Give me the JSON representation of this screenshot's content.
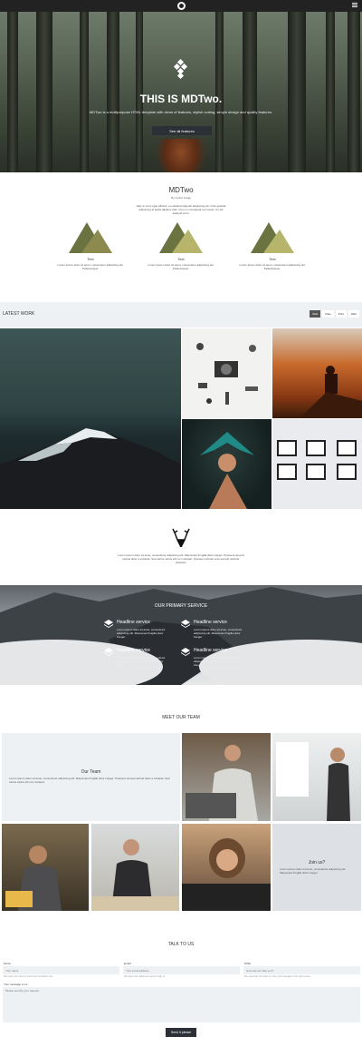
{
  "hero": {
    "title": "THIS IS MDTwo.",
    "subtitle": "MDTwo is a multipurpose HTML template with clean of features, stylish coding, simple design and quality features.",
    "button": "See all features"
  },
  "about": {
    "title": "MDTwo",
    "small": "By Andrei Iosagi",
    "text": "Nam in enim eget efficitur, eu eleifend eligendi adipiscing elit. Cras gravida adipiscing at ligula dapibus duis. Cum cu consequat commodo. Cu elit eleifend enim."
  },
  "features": [
    {
      "title": "Text",
      "desc": "Lorem ipsum dolor sit amet, consectetur adipiscing elit. Pellentesque."
    },
    {
      "title": "Text",
      "desc": "Lorem ipsum dolor sit amet, consectetur adipiscing elit. Pellentesque."
    },
    {
      "title": "Text",
      "desc": "Lorem ipsum dolor sit amet, consectetur adipiscing elit. Pellentesque."
    }
  ],
  "work": {
    "label": "LATEST WORK",
    "filters": [
      "Web",
      "Files",
      "Print",
      "Web"
    ]
  },
  "quote": {
    "text": "Lorem ipsum dolor sit amet, consectetur adipiscing elit. Maecenas fringilla dolor integer. Praesent tempus lacinia dolor a volutpat. Sed varius varius elit non volutpat. Quisque pulvinar eros sed elit pulvinar pharetra."
  },
  "services": {
    "title": "OUR PRIMARY SERVICE",
    "items": [
      {
        "title": "Headline service",
        "desc": "Lorem ipsum dolor sit amet, consectetur adipiscing elit. Maecenas fringilla dolor integer."
      },
      {
        "title": "Headline service",
        "desc": "Lorem ipsum dolor sit amet, consectetur adipiscing elit. Maecenas fringilla dolor integer."
      },
      {
        "title": "Headline service",
        "desc": "Lorem ipsum dolor sit amet, consectetur adipiscing elit. Maecenas fringilla dolor integer."
      },
      {
        "title": "Headline service",
        "desc": "Lorem ipsum dolor sit amet, consectetur adipiscing elit. Maecenas fringilla dolor integer."
      }
    ]
  },
  "team": {
    "title": "MEET OUR TEAM",
    "card_title": "Our Team",
    "card_text": "Lorem ipsum dolor sit amet, consectetur adipiscing elit. Maecenas fringilla dolor integer. Praesent tempus lacinia dolor a volutpat. Sed varius varius elit non volutpat.",
    "join_title": "Join us?",
    "join_text": "Lorem ipsum dolor sit amet, consectetur adipiscing elit. Maecenas fringilla dolor integer."
  },
  "contact": {
    "title": "TALK TO US",
    "name_label": "Name",
    "name_placeholder": "Your name",
    "name_hint": "We need your name to know how to address you.",
    "email_label": "Email",
    "email_placeholder": "Your email address",
    "email_hint": "We need your address to send a reply to.",
    "what_label": "What",
    "what_placeholder": "How can we help you?",
    "what_hint": "We need that, but helps to route your message to the right person.",
    "msg_label": "Your message to us",
    "msg_placeholder": "Please specify your request",
    "send": "Send it please"
  },
  "colors": {
    "dark": "#222222",
    "light_panel": "#eef1f4",
    "triangle_dark": "#6b7340",
    "triangle_light": "#b7b46c"
  }
}
